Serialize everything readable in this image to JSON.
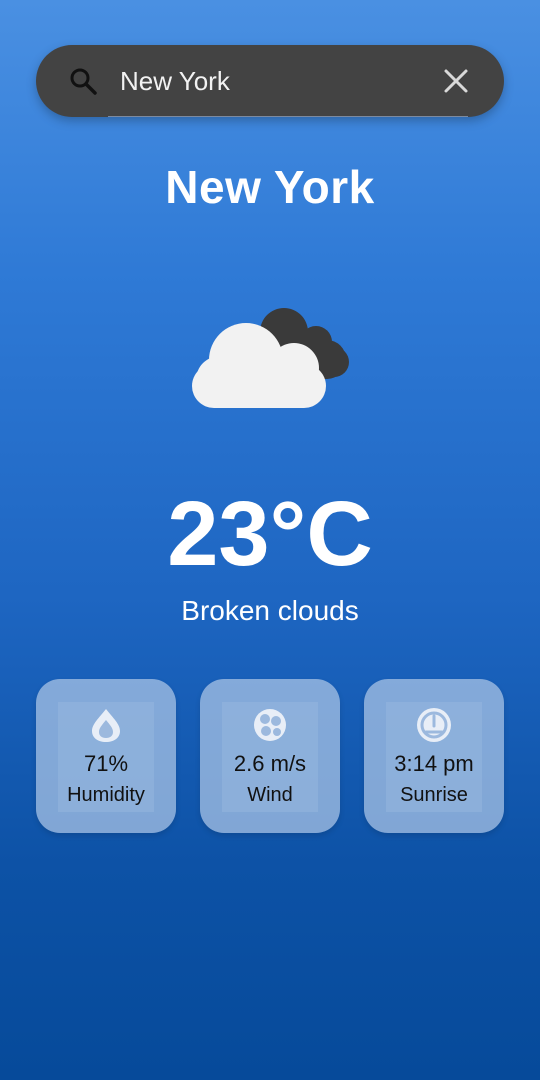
{
  "search": {
    "value": "New York",
    "icon": "search-icon",
    "clear_icon": "close-icon"
  },
  "city": "New York",
  "weather": {
    "icon": "broken-clouds-icon",
    "temperature": "23°C",
    "description": "Broken clouds"
  },
  "cards": [
    {
      "icon": "humidity-icon",
      "value": "71%",
      "label": "Humidity"
    },
    {
      "icon": "wind-icon",
      "value": "2.6 m/s",
      "label": "Wind"
    },
    {
      "icon": "sunrise-icon",
      "value": "3:14 pm",
      "label": "Sunrise"
    }
  ],
  "colors": {
    "background_top": "#4a90e2",
    "background_bottom": "#064a9a",
    "search_bar": "#434343",
    "card": "#adc6e6"
  }
}
